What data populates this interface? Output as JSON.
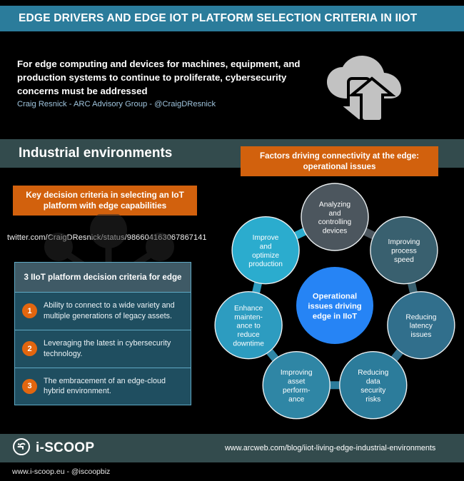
{
  "header": {
    "title": "EDGE DRIVERS AND EDGE IOT PLATFORM SELECTION CRITERIA IN IIOT",
    "band_color": "#2b7c9b"
  },
  "hero": {
    "quote": "For edge computing and devices for machines, equipment, and production systems to continue to proliferate, cybersecurity concerns must be addressed",
    "attribution": "Craig Resnick - ARC Advisory Group - @CraigDResnick",
    "icon": "cloud-upload-download-icon"
  },
  "section": {
    "title": "Industrial environments",
    "band_color": "#334b4d"
  },
  "banners": {
    "right": "Factors driving connectivity at the edge: operational issues",
    "left": "Key decision criteria in selecting an IoT platform with edge capabilities",
    "color": "#d2610d"
  },
  "source_link": "twitter.com/CraigDResnick/status/986604163067867141",
  "criteria_card": {
    "heading": "3 IIoT platform decision criteria for edge",
    "items": [
      {
        "number": "1",
        "text": "Ability to connect to a wide variety and multiple generations of legacy assets."
      },
      {
        "number": "2",
        "text": "Leveraging the latest in cybersecurity technology."
      },
      {
        "number": "3",
        "text": "The embracement of an edge-cloud hybrid environment."
      }
    ]
  },
  "chart_data": {
    "type": "diagram",
    "title": "Factors driving connectivity at the edge: operational issues",
    "center": {
      "label": "Operational issues driving edge in IIoT",
      "color": "#2684f5"
    },
    "nodes": [
      {
        "label": "Analyzing and controlling devices",
        "lines": [
          "Analyzing",
          "and",
          "controlling",
          "devices"
        ],
        "color": "#4c565e",
        "angle_deg": 90
      },
      {
        "label": "Improving process speed",
        "lines": [
          "Improving",
          "process",
          "speed"
        ],
        "color": "#39606f",
        "angle_deg": 38.6
      },
      {
        "label": "Reducing latency issues",
        "lines": [
          "Reducing",
          "latency",
          "issues"
        ],
        "color": "#316f8c",
        "angle_deg": -12.9
      },
      {
        "label": "Reducing data security risks",
        "lines": [
          "Reducing",
          "data",
          "security",
          "risks"
        ],
        "color": "#2c7c9b",
        "angle_deg": -64.3
      },
      {
        "label": "Improving asset performance",
        "lines": [
          "Improving",
          "asset",
          "perform-",
          "ance"
        ],
        "color": "#2f86a5",
        "angle_deg": -115.7
      },
      {
        "label": "Enhance maintenance to reduce downtime",
        "lines": [
          "Enhance",
          "mainten-",
          "ance to",
          "reduce",
          "downtime"
        ],
        "color": "#2d9cc0",
        "angle_deg": -167.1
      },
      {
        "label": "Improve and optimize production",
        "lines": [
          "Improve",
          "and",
          "optimize",
          "production"
        ],
        "color": "#2bacce",
        "angle_deg": 141.4
      }
    ]
  },
  "footer": {
    "brand": "i-SCOOP",
    "logo": "i-scoop-circle-logo",
    "url": "www.arcweb.com/blog/iiot-living-edge-industrial-environments",
    "bottom": "www.i-scoop.eu - @iscoopbiz"
  }
}
